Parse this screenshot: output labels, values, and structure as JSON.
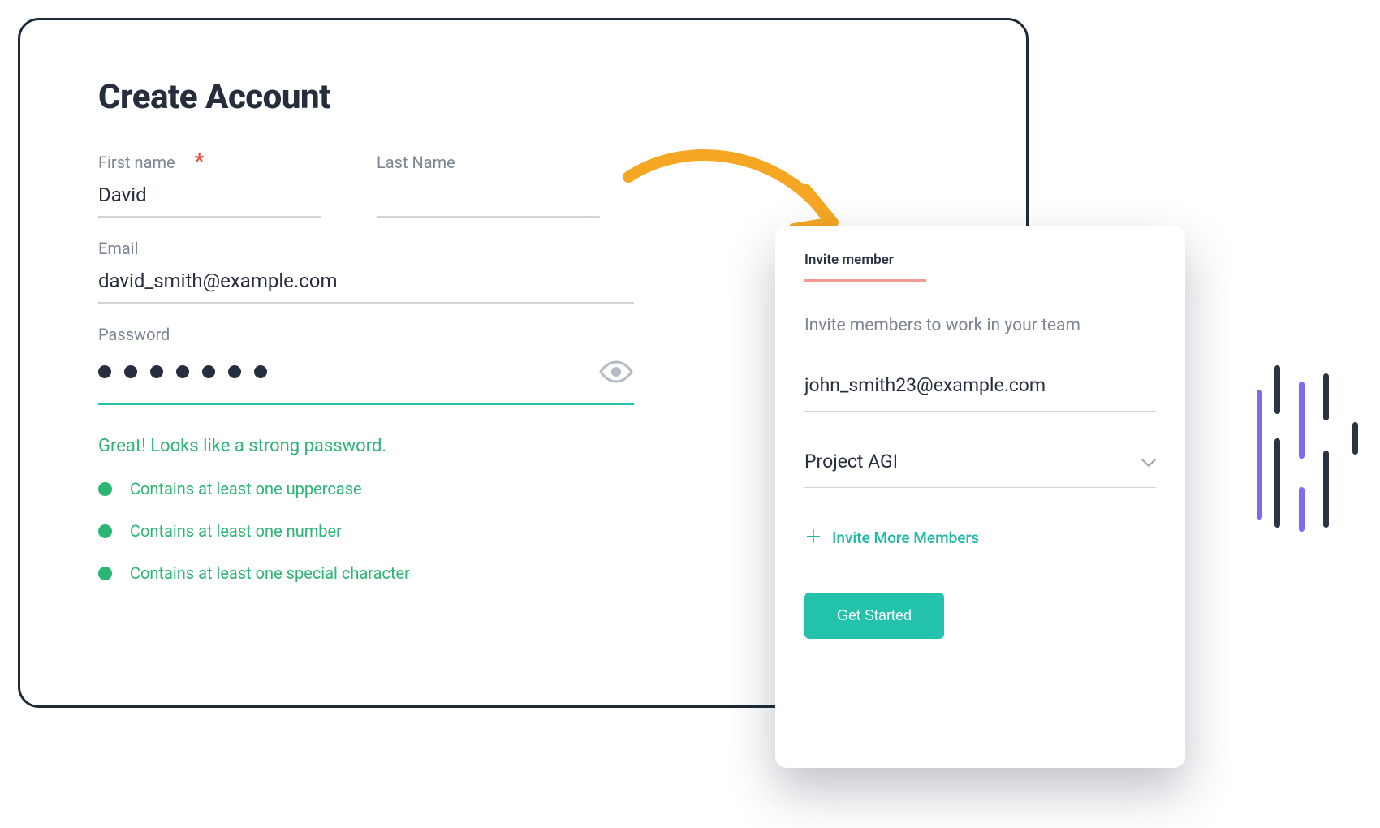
{
  "title": "Create Account",
  "fields": {
    "first_name": {
      "label": "First name",
      "value": "David",
      "required": true
    },
    "last_name": {
      "label": "Last Name",
      "value": ""
    },
    "email": {
      "label": "Email",
      "value": "david_smith@example.com"
    },
    "password": {
      "label": "Password",
      "dots": 7
    }
  },
  "password_feedback": "Great! Looks like a strong password.",
  "password_rules": [
    "Contains at least one uppercase",
    "Contains at least one number",
    "Contains at least one special character"
  ],
  "invite": {
    "tab": "Invite member",
    "subhead": "Invite members to work in your team",
    "member_email": "john_smith23@example.com",
    "project": "Project AGI",
    "more_label": "Invite More Members",
    "cta": "Get Started"
  },
  "colors": {
    "accent_teal": "#22c2ad",
    "success": "#2bb673",
    "arrow": "#f5a623",
    "tab_underline": "#f49a8f",
    "deco_purple": "#7c6cf2",
    "deco_dark": "#2b3445"
  }
}
